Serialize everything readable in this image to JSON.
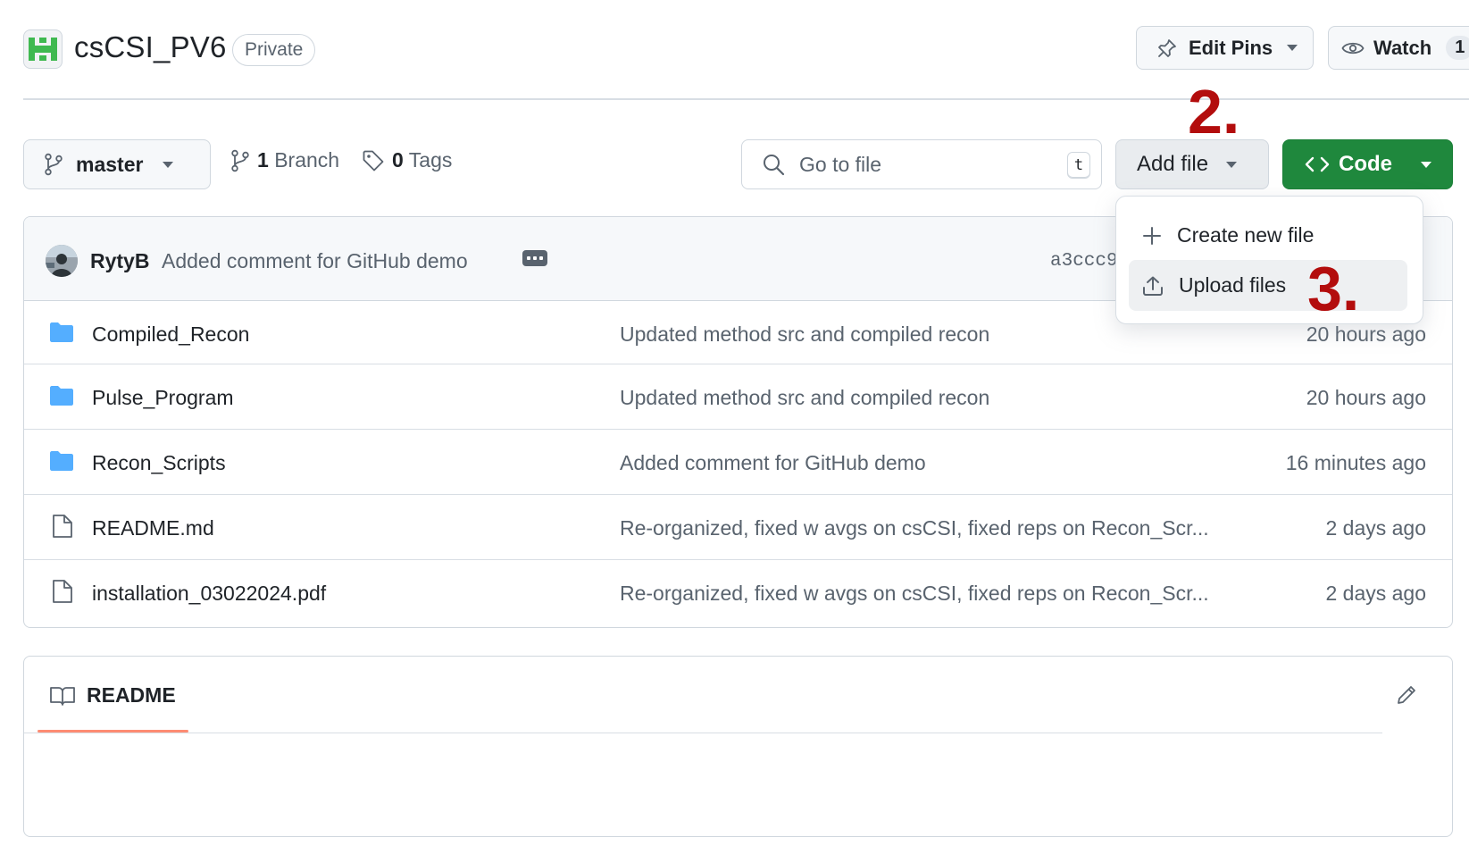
{
  "repo": {
    "name": "csCSI_PV6",
    "visibility": "Private",
    "edit_pins_label": "Edit Pins",
    "watch_label": "Watch",
    "watch_count": "1"
  },
  "toolbar": {
    "branch_name": "master",
    "branch_count_num": "1",
    "branch_count_label": "Branch",
    "tag_count_num": "0",
    "tag_count_label": "Tags",
    "go_to_file_placeholder": "Go to file",
    "go_to_file_shortcut": "t",
    "add_file_label": "Add file",
    "code_label": "Code"
  },
  "add_file_menu": {
    "items": [
      {
        "label": "Create new file",
        "icon": "plus-icon"
      },
      {
        "label": "Upload files",
        "icon": "upload-icon"
      }
    ]
  },
  "annotations": {
    "step2": "2.",
    "step3": "3."
  },
  "latest_commit": {
    "author": "RytyB",
    "message": "Added comment for GitHub demo",
    "hash": "a3ccc9b"
  },
  "files": [
    {
      "name": "Compiled_Recon",
      "type": "folder",
      "message": "Updated method src and compiled recon",
      "time": "20 hours ago"
    },
    {
      "name": "Pulse_Program",
      "type": "folder",
      "message": "Updated method src and compiled recon",
      "time": "20 hours ago"
    },
    {
      "name": "Recon_Scripts",
      "type": "folder",
      "message": "Added comment for GitHub demo",
      "time": "16 minutes ago"
    },
    {
      "name": "README.md",
      "type": "file",
      "message": "Re-organized, fixed w avgs on csCSI, fixed reps on Recon_Scr...",
      "time": "2 days ago"
    },
    {
      "name": "installation_03022024.pdf",
      "type": "file",
      "message": "Re-organized, fixed w avgs on csCSI, fixed reps on Recon_Scr...",
      "time": "2 days ago"
    }
  ],
  "readme": {
    "tab_label": "README"
  },
  "colors": {
    "code_button": "#1f883d",
    "folder_icon": "#54aeff",
    "annotation": "#b30d0d",
    "readme_underline": "#fd8c73"
  }
}
